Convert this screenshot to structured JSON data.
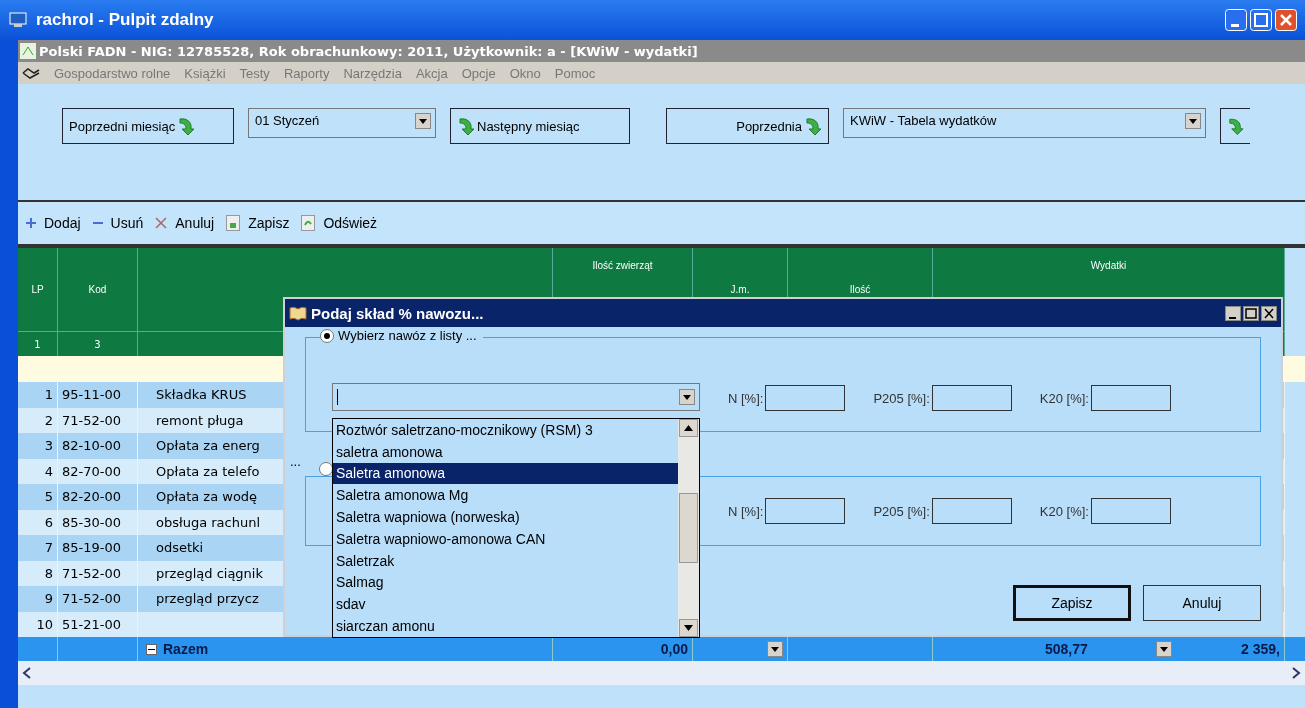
{
  "window": {
    "title": "rachrol - Pulpit zdalny"
  },
  "app_bar": {
    "title": "Polski FADN - NIG: 12785528,  Rok obrachunkowy: 2011, Użytkownik: a - [KWiW - wydatki]"
  },
  "menu": [
    "Gospodarstwo rolne",
    "Książki",
    "Testy",
    "Raporty",
    "Narzędzia",
    "Akcja",
    "Opcje",
    "Okno",
    "Pomoc"
  ],
  "nav": {
    "prev_month": "Poprzedni miesiąc",
    "month": "01 Styczeń",
    "next_month": "Następny miesiąc",
    "prev": "Poprzednia",
    "table_select": "KWiW - Tabela wydatków"
  },
  "actions": [
    {
      "label": "Dodaj",
      "kind": "add"
    },
    {
      "label": "Usuń",
      "kind": "remove"
    },
    {
      "label": "Anuluj",
      "kind": "cancel"
    },
    {
      "label": "Zapisz",
      "kind": "save"
    },
    {
      "label": "Odśwież",
      "kind": "refresh"
    }
  ],
  "table": {
    "columns": [
      "LP",
      "Kod",
      "",
      "Ilość zwierząt",
      "J.m.",
      "Ilość",
      "Wydatki"
    ],
    "index_row": [
      "1",
      "3"
    ],
    "rows": [
      {
        "lp": "1",
        "code": "95-11-00",
        "name": "Składka KRUS"
      },
      {
        "lp": "2",
        "code": "71-52-00",
        "name": "remont pługa"
      },
      {
        "lp": "3",
        "code": "82-10-00",
        "name": "Opłata za energ"
      },
      {
        "lp": "4",
        "code": "82-70-00",
        "name": "Opłata za telefo"
      },
      {
        "lp": "5",
        "code": "82-20-00",
        "name": "Opłata za wodę"
      },
      {
        "lp": "6",
        "code": "85-30-00",
        "name": "obsługa rachunl"
      },
      {
        "lp": "7",
        "code": "85-19-00",
        "name": "odsetki"
      },
      {
        "lp": "8",
        "code": "71-52-00",
        "name": "przegląd ciągnik"
      },
      {
        "lp": "9",
        "code": "71-52-00",
        "name": "przegląd przycz"
      },
      {
        "lp": "10",
        "code": "51-21-00",
        "name": ""
      }
    ],
    "total": {
      "label": "Razem",
      "animals": "0,00",
      "amount": "508,77",
      "expenses": "2 359,"
    }
  },
  "dialog": {
    "title": "Podaj skład % nawozu...",
    "groups": [
      {
        "label": "Wybierz nawóz z listy ...",
        "selected": true,
        "fields": [
          "N [%]:",
          "P205 [%]:",
          "K20 [%]:"
        ]
      },
      {
        "selected": false,
        "fields": [
          "N [%]:",
          "P205 [%]:",
          "K20 [%]:"
        ]
      }
    ],
    "ellipsis": "...",
    "list": [
      {
        "label": "Roztwór saletrzano-mocznikowy (RSM) 3",
        "selected": false
      },
      {
        "label": "saletra amonowa",
        "selected": false
      },
      {
        "label": "Saletra amonowa",
        "selected": true
      },
      {
        "label": "Saletra amonowa Mg",
        "selected": false
      },
      {
        "label": "Saletra wapniowa (norweska)",
        "selected": false
      },
      {
        "label": "Saletra wapniowo-amonowa CAN",
        "selected": false
      },
      {
        "label": "Saletrzak",
        "selected": false
      },
      {
        "label": "Salmag",
        "selected": false
      },
      {
        "label": "sdav",
        "selected": false
      },
      {
        "label": "siarczan amonu",
        "selected": false
      }
    ],
    "buttons": [
      {
        "label": "Zapisz",
        "default": true
      },
      {
        "label": "Anuluj",
        "default": false
      }
    ]
  }
}
